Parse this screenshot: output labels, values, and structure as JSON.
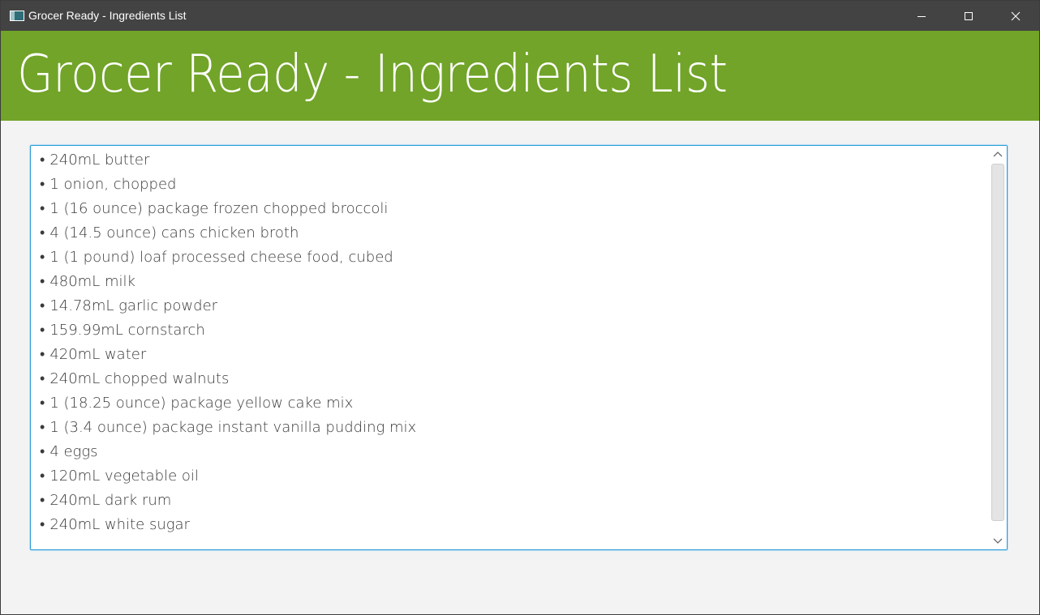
{
  "window": {
    "title": "Grocer Ready - Ingredients List"
  },
  "header": {
    "title": "Grocer Ready - Ingredients List",
    "color": "#71a428"
  },
  "ingredients": {
    "bullet": "•",
    "items": [
      "240mL butter",
      "1 onion, chopped",
      "1 (16 ounce) package frozen chopped broccoli",
      "4 (14.5 ounce) cans chicken broth",
      "1 (1 pound) loaf processed cheese food, cubed",
      "480mL milk",
      "14.78mL garlic powder",
      "159.99mL cornstarch",
      "420mL water",
      "240mL chopped walnuts",
      "1 (18.25 ounce) package yellow cake mix",
      "1 (3.4 ounce) package instant vanilla pudding mix",
      "4 eggs",
      "120mL vegetable oil",
      "240mL dark rum",
      "240mL white sugar"
    ]
  },
  "icons": {
    "app": "app-window-icon",
    "minimize": "minimize-icon",
    "maximize": "maximize-icon",
    "close": "close-icon",
    "scroll_up": "chevron-up-icon",
    "scroll_down": "chevron-down-icon"
  },
  "colors": {
    "titlebar": "#434343",
    "focus_border": "#2b9bd8",
    "background": "#f3f3f3"
  }
}
